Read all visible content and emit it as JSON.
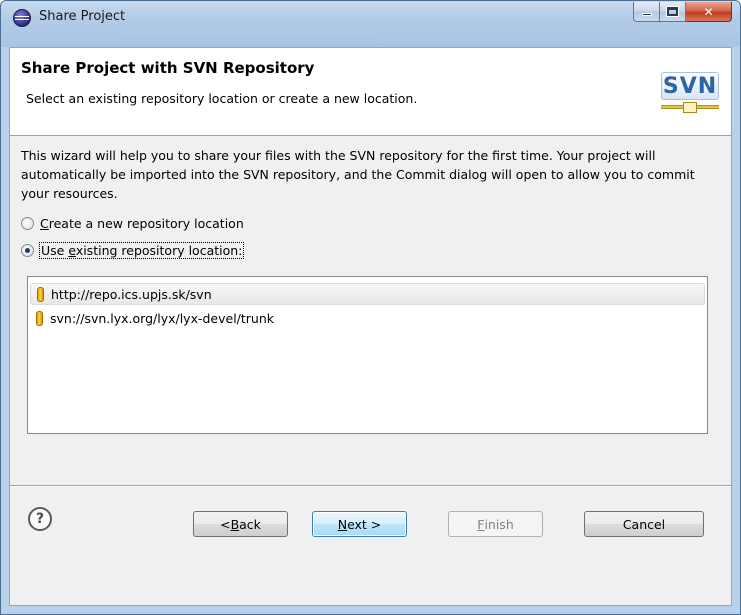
{
  "window": {
    "title": "Share Project"
  },
  "banner": {
    "title": "Share Project with SVN Repository",
    "subtitle": "Select an existing repository location or create a new location.",
    "logo_text": "SVN"
  },
  "description": "This wizard will help you to share your files with the SVN repository for the first time. Your project will automatically be imported into the SVN repository, and the Commit dialog will open to allow you to commit your resources.",
  "options": [
    {
      "mnemonic": "C",
      "rest": "reate a new repository location",
      "checked": false
    },
    {
      "prefix": "Use ",
      "mnemonic": "e",
      "rest": "xisting repository location:",
      "checked": true
    }
  ],
  "repositories": [
    {
      "url": "http://repo.ics.upjs.sk/svn",
      "selected": true
    },
    {
      "url": "svn://svn.lyx.org/lyx/lyx-devel/trunk",
      "selected": false
    }
  ],
  "buttons": {
    "help": "?",
    "back": {
      "prefix": "< ",
      "mnemonic": "B",
      "rest": "ack"
    },
    "next": {
      "mnemonic": "N",
      "rest": "ext >"
    },
    "finish": {
      "mnemonic": "F",
      "rest": "inish"
    },
    "cancel": "Cancel"
  },
  "colors": {
    "default_button_border": "#3c7fb1",
    "repo_icon": "#ffd24a"
  }
}
